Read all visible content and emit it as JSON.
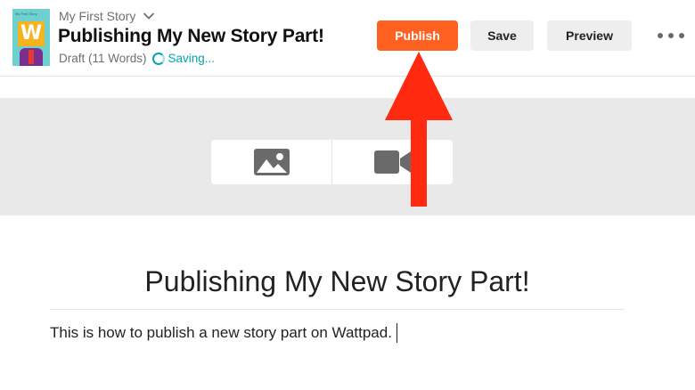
{
  "header": {
    "cover_tiny_text": "My First Story",
    "cover_letter": "W",
    "story_name": "My First Story",
    "part_title": "Publishing My New Story Part!",
    "status_text": "Draft (11 Words)",
    "saving_text": "Saving...",
    "publish_label": "Publish",
    "save_label": "Save",
    "preview_label": "Preview"
  },
  "media": {
    "image_icon": "image-icon",
    "video_icon": "video-camera-icon"
  },
  "editor": {
    "title": "Publishing My New Story Part!",
    "body": "This is how to publish a new story part on Wattpad."
  },
  "colors": {
    "publish": "#ff6122",
    "accent": "#00a5b6",
    "annotation_arrow": "#ff2a10"
  }
}
